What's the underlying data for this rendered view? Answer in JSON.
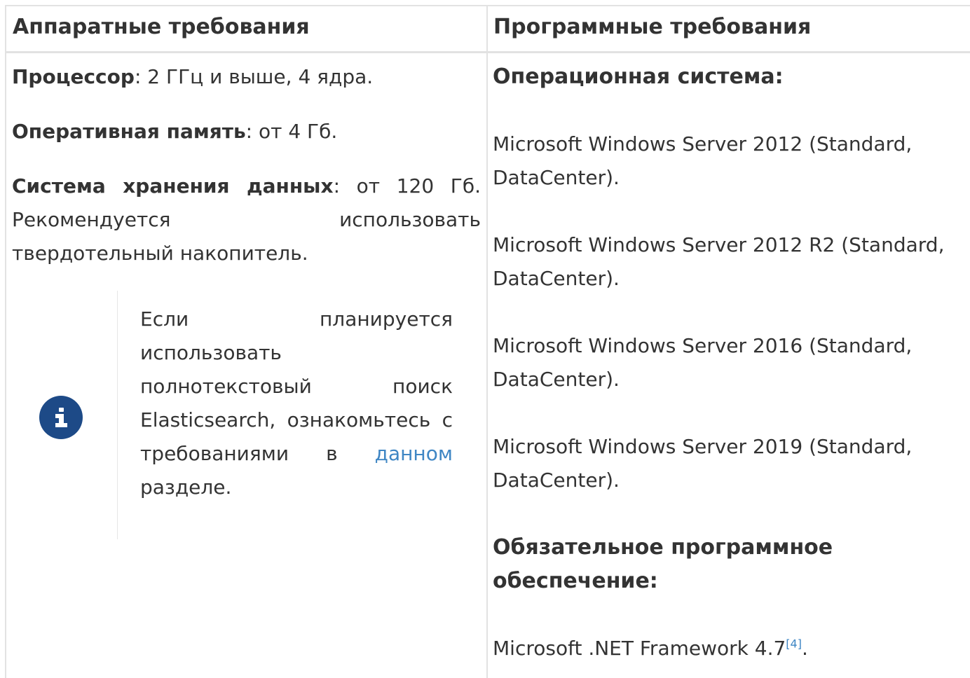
{
  "table": {
    "headers": {
      "hardware": "Аппаратные требования",
      "software": "Программные требования"
    },
    "hardware": {
      "cpu_label": "Процессор",
      "cpu_value": ": 2 ГГц и выше, 4 ядра.",
      "ram_label": "Оперативная память",
      "ram_value": ": от 4 Гб.",
      "storage_label": "Система хранения данных",
      "storage_value": ": от 120 Гб. Рекомендуется использовать твердотельный накопитель.",
      "note": {
        "icon": "info-circle-icon",
        "text_before": "Если планируется использовать полнотекстовый поиск Elasticsearch, ознакомьтесь с требованиями в ",
        "link": "данном",
        "text_after": " разделе."
      }
    },
    "software": {
      "os_heading": "Операционная система:",
      "os_items": [
        "Microsoft Windows Server 2012 (Standard, DataCenter).",
        "Microsoft Windows Server 2012 R2 (Standard, DataCenter).",
        "Microsoft Windows Server 2016 (Standard, DataCenter).",
        "Microsoft Windows Server 2019 (Standard, DataCenter)."
      ],
      "required_heading": "Обязательное программное обеспечение:",
      "required_item": "Microsoft .NET Framework 4.7",
      "footnote_ref": "[4]",
      "required_item_end": "."
    }
  },
  "colors": {
    "text": "#333333",
    "border": "#e2e2e2",
    "link": "#3f86c4",
    "info_icon": "#1d4a87"
  }
}
